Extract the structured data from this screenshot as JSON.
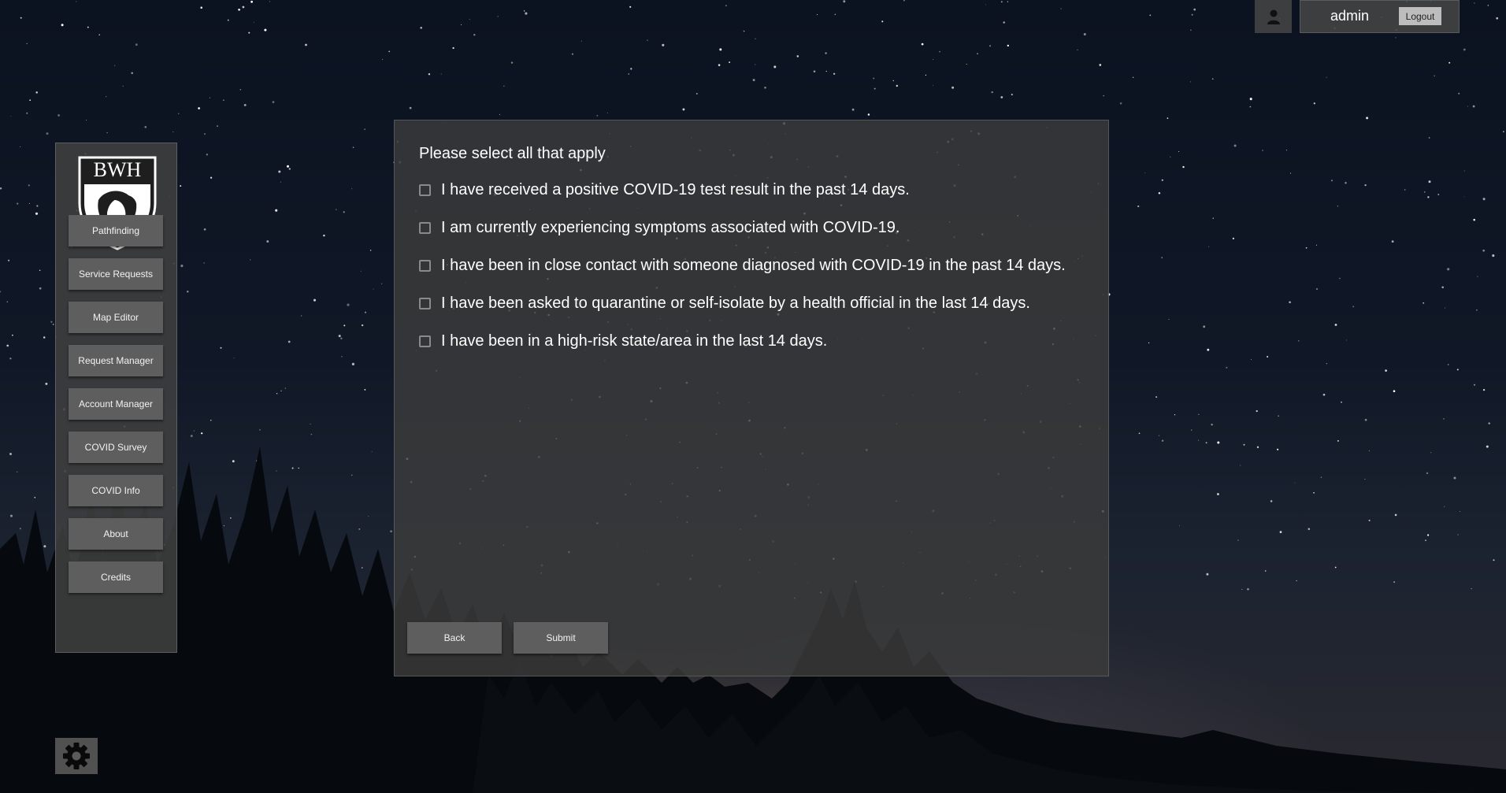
{
  "header": {
    "username": "admin",
    "logout_label": "Logout",
    "user_icon": "user-icon"
  },
  "sidebar": {
    "logo_text": "BWH",
    "items": [
      {
        "label": "Pathfinding"
      },
      {
        "label": "Service Requests"
      },
      {
        "label": "Map Editor"
      },
      {
        "label": "Request Manager"
      },
      {
        "label": "Account Manager"
      },
      {
        "label": "COVID Survey"
      },
      {
        "label": "COVID Info"
      },
      {
        "label": "About"
      },
      {
        "label": "Credits"
      }
    ],
    "settings_icon": "gear-icon"
  },
  "survey": {
    "prompt": "Please select all that apply",
    "options": [
      {
        "label": "I have received a positive COVID-19 test result in the past 14 days.",
        "checked": false
      },
      {
        "label": "I am currently experiencing symptoms associated with COVID-19.",
        "checked": false
      },
      {
        "label": "I have been in close contact with someone diagnosed with COVID-19 in the past 14 days.",
        "checked": false
      },
      {
        "label": "I have been asked to quarantine or self-isolate by a health official in the last 14 days.",
        "checked": false
      },
      {
        "label": "I have been in a high-risk state/area in the last 14 days.",
        "checked": false
      }
    ],
    "back_label": "Back",
    "submit_label": "Submit"
  },
  "colors": {
    "panel": "#3c3c3c",
    "button": "#5e5e5e",
    "text": "#ffffff",
    "logout_button": "#bdbdbd"
  }
}
